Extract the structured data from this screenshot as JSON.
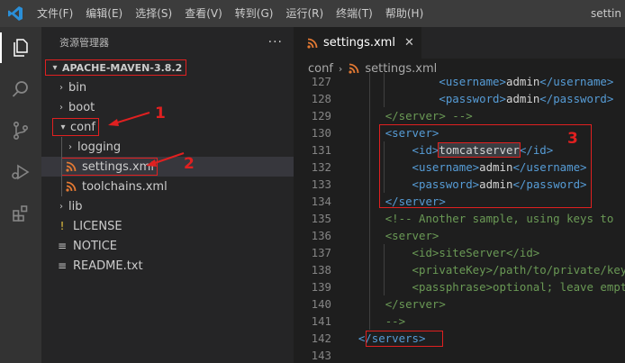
{
  "titlebar": {
    "menus": [
      "文件(F)",
      "编辑(E)",
      "选择(S)",
      "查看(V)",
      "转到(G)",
      "运行(R)",
      "终端(T)",
      "帮助(H)"
    ],
    "title": "settin"
  },
  "sidebar": {
    "header": "资源管理器",
    "more": "···",
    "root": "APACHE-MAVEN-3.8.2",
    "items": [
      {
        "label": "bin",
        "type": "folder",
        "state": "collapsed"
      },
      {
        "label": "boot",
        "type": "folder",
        "state": "collapsed"
      },
      {
        "label": "conf",
        "type": "folder",
        "state": "expanded"
      },
      {
        "label": "logging",
        "type": "folder",
        "state": "collapsed"
      },
      {
        "label": "settings.xml",
        "type": "xml",
        "state": "selected"
      },
      {
        "label": "toolchains.xml",
        "type": "xml"
      },
      {
        "label": "lib",
        "type": "folder",
        "state": "collapsed"
      },
      {
        "label": "LICENSE",
        "type": "text-file"
      },
      {
        "label": "NOTICE",
        "type": "text-file"
      },
      {
        "label": "README.txt",
        "type": "text-file"
      }
    ]
  },
  "annotations": {
    "a1": "1",
    "a2": "2",
    "a3": "3"
  },
  "editor": {
    "tab": "settings.xml",
    "close": "✕",
    "breadcrumb": [
      "conf",
      "settings.xml"
    ],
    "lines": [
      {
        "n": "127",
        "parts": [
          [
            "tg",
            "<"
          ],
          [
            "tg",
            "username"
          ],
          [
            "tg",
            ">"
          ],
          [
            "tx",
            "admin"
          ],
          [
            "tg",
            "</"
          ],
          [
            "tg",
            "username"
          ],
          [
            "tg",
            ">"
          ]
        ],
        "cls": "cm"
      },
      {
        "n": "128",
        "parts": [
          [
            "tg",
            "<"
          ],
          [
            "tg",
            "password"
          ],
          [
            "tg",
            ">"
          ],
          [
            "tx",
            "admin"
          ],
          [
            "tg",
            "</"
          ],
          [
            "tg",
            "password"
          ],
          [
            "tg",
            ">"
          ]
        ],
        "cls": "cm"
      },
      {
        "n": "129",
        "parts": [
          [
            "cm",
            "</server> -->"
          ]
        ]
      },
      {
        "n": "130",
        "parts": [
          [
            "tg",
            "<server>"
          ]
        ]
      },
      {
        "n": "131",
        "parts": [
          [
            "tg",
            "<id>"
          ],
          [
            "tx",
            "tomcatserver"
          ],
          [
            "tg",
            "</id>"
          ]
        ]
      },
      {
        "n": "132",
        "parts": [
          [
            "tg",
            "<username>"
          ],
          [
            "tx",
            "admin"
          ],
          [
            "tg",
            "</username>"
          ]
        ]
      },
      {
        "n": "133",
        "parts": [
          [
            "tg",
            "<password>"
          ],
          [
            "tx",
            "admin"
          ],
          [
            "tg",
            "</password>"
          ]
        ]
      },
      {
        "n": "134",
        "parts": [
          [
            "tg",
            "</server>"
          ]
        ]
      },
      {
        "n": "135",
        "parts": [
          [
            "cm",
            "<!-- Another sample, using keys to"
          ]
        ]
      },
      {
        "n": "136",
        "parts": [
          [
            "cm",
            "<server>"
          ]
        ]
      },
      {
        "n": "137",
        "parts": [
          [
            "cm",
            "<id>siteServer</id>"
          ]
        ]
      },
      {
        "n": "138",
        "parts": [
          [
            "cm",
            "<privateKey>/path/to/private/key<"
          ]
        ]
      },
      {
        "n": "139",
        "parts": [
          [
            "cm",
            "<passphrase>optional; leave empty"
          ]
        ]
      },
      {
        "n": "140",
        "parts": [
          [
            "cm",
            "</server>"
          ]
        ]
      },
      {
        "n": "141",
        "parts": [
          [
            "cm",
            "-->"
          ]
        ]
      },
      {
        "n": "142",
        "parts": [
          [
            "tg",
            "</servers>"
          ]
        ]
      },
      {
        "n": "143",
        "parts": []
      }
    ]
  },
  "colors": {
    "accent_red": "#e02020",
    "tag": "#569cd6",
    "comment": "#6a9955",
    "xml_icon": "#e37933"
  }
}
